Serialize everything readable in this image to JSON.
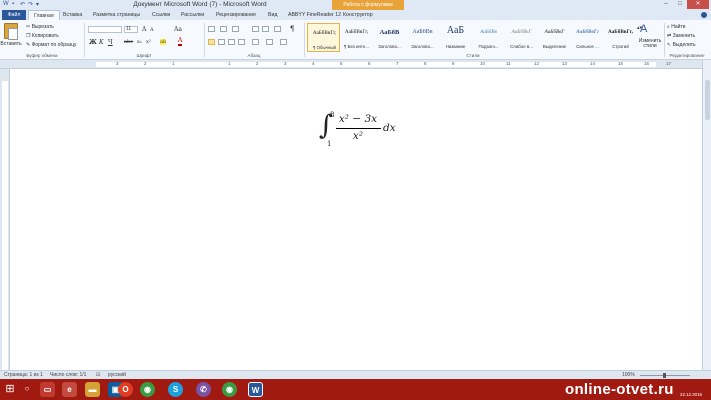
{
  "window": {
    "title": "Документ Microsoft Word (7) - Microsoft Word",
    "context_header": "Работа с формулами",
    "controls": {
      "minimize": "–",
      "maximize": "□",
      "close": "✕"
    }
  },
  "tabs": [
    {
      "label": "Файл"
    },
    {
      "label": "Главная"
    },
    {
      "label": "Вставка"
    },
    {
      "label": "Разметка страницы"
    },
    {
      "label": "Ссылки"
    },
    {
      "label": "Рассылки"
    },
    {
      "label": "Рецензирование"
    },
    {
      "label": "Вид"
    },
    {
      "label": "ABBYY FineReader 12"
    },
    {
      "label": "Конструктор"
    }
  ],
  "ribbon": {
    "clipboard": {
      "paste_label": "Вставить",
      "cut_label": "Вырезать",
      "copy_label": "Копировать",
      "format_painter_label": "Формат по образцу",
      "group_label": "Буфер обмена"
    },
    "font": {
      "font_name": "",
      "font_size": "11",
      "group_label": "Шрифт",
      "bold": "Ж",
      "italic": "К",
      "underline": "Ч",
      "strike": "abe",
      "subscript": "x₂",
      "superscript": "x²",
      "grow": "A",
      "shrink": "A",
      "case": "Aa",
      "highlight": "ab",
      "color": "A"
    },
    "paragraph": {
      "group_label": "Абзац",
      "pilcrow": "¶"
    },
    "styles": {
      "group_label": "Стили",
      "items": [
        {
          "preview": "АаБбВвГг,",
          "name": "¶ Обычный"
        },
        {
          "preview": "АаБбВвГг,",
          "name": "¶ Без инте..."
        },
        {
          "preview": "АаБбВ",
          "name": "Заголово..."
        },
        {
          "preview": "АаБбВв",
          "name": "Заголово..."
        },
        {
          "preview": "АаБ",
          "name": "Название"
        },
        {
          "preview": "АаБбВв",
          "name": "Подзаго..."
        },
        {
          "preview": "АаБбВвГ",
          "name": "Слабое в..."
        },
        {
          "preview": "АаБбВвГ",
          "name": "Выделение"
        },
        {
          "preview": "АаБбВвГг",
          "name": "Сильное ..."
        },
        {
          "preview": "АаБбВвГг,",
          "name": "Строгий"
        }
      ],
      "change_styles_label": "Изменить стили"
    },
    "editing": {
      "group_label": "Редактирование",
      "find_label": "Найти",
      "replace_label": "Заменить",
      "select_label": "Выделить"
    }
  },
  "ruler": {
    "numbers": [
      "3",
      "2",
      "1",
      "1",
      "2",
      "3",
      "4",
      "5",
      "6",
      "7",
      "8",
      "9",
      "10",
      "11",
      "12",
      "13",
      "14",
      "15",
      "16",
      "17"
    ]
  },
  "formula": {
    "integral": "∫",
    "upper_limit": "8",
    "lower_limit": "1",
    "numerator": "x² − 3x",
    "denominator": "x²",
    "differential": "dx"
  },
  "status": {
    "page": "Страница: 1 из 1",
    "words": "Число слов: 1/1",
    "language": "русский",
    "zoom": "100%"
  },
  "taskbar": {
    "start": "⊞",
    "search": "○",
    "watermark": "online-otvet.ru",
    "date": "22.12.2016"
  },
  "colors": {
    "accent": "#2b579a",
    "taskbar": "#a11a12",
    "context_tab": "#e8a33a"
  }
}
